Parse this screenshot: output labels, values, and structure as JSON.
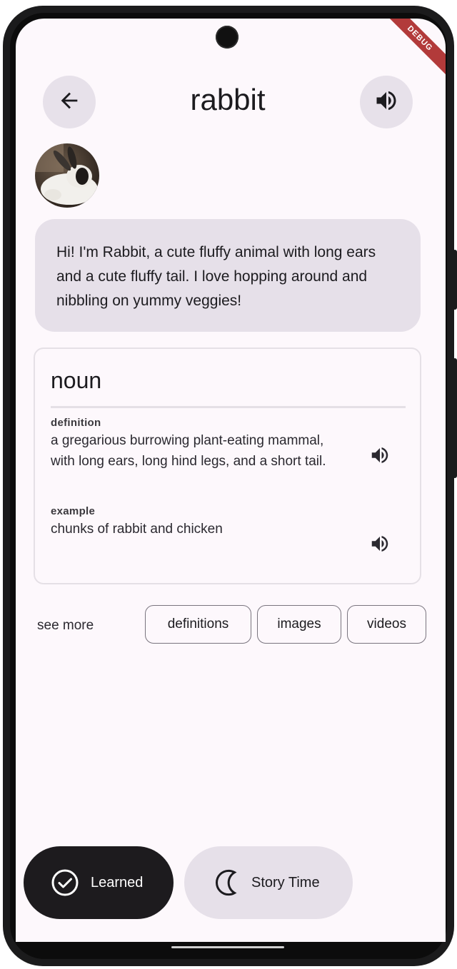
{
  "header": {
    "title": "rabbit",
    "back_icon": "arrow-left-icon",
    "speak_icon": "speaker-icon"
  },
  "debug_banner": "DEBUG",
  "status_bar": {
    "time": "",
    "icons": ""
  },
  "bubble": {
    "text": "Hi! I'm Rabbit, a cute fluffy animal with long ears and a cute fluffy tail. I love hopping around and nibbling on yummy veggies!"
  },
  "card": {
    "part_of_speech": "noun",
    "definition_label": "definition",
    "definition": "a gregarious burrowing plant-eating mammal, with long ears, long hind legs, and a short tail.",
    "example_label": "example",
    "example": "chunks of rabbit and chicken"
  },
  "see_more": {
    "label": "see more",
    "chips": [
      "definitions",
      "images",
      "videos"
    ]
  },
  "actions": {
    "learned": "Learned",
    "story": "Story Time"
  },
  "colors": {
    "background": "#fdf8fc",
    "bubble": "#e6e0e9",
    "primary_dark": "#1d1b1e",
    "debug": "#b23a3a"
  }
}
